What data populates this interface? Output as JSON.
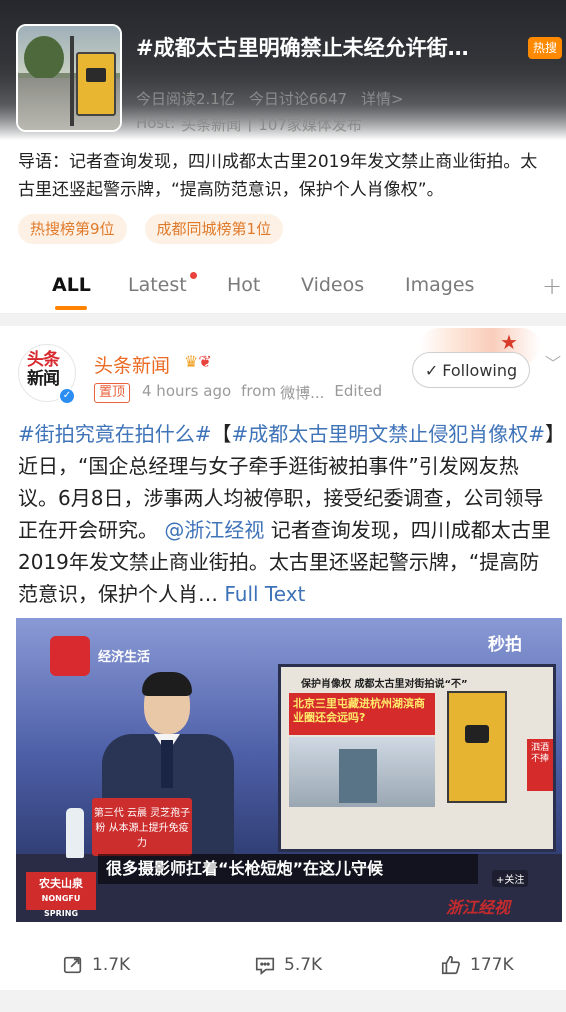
{
  "topic": {
    "title": "#成都太古里明确禁止未经允许街…",
    "badge": "热搜",
    "reads": "今日阅读2.1亿",
    "discussions": "今日讨论6647",
    "details": "详情>",
    "host_label": "Host:",
    "host": "头条新闻",
    "media_count": "107家媒体发布",
    "guide_prefix": "导语：",
    "guide_text": "记者查询发现，四川成都太古里2019年发文禁止商业街拍。太古里还竖起警示牌，“提高防范意识，保护个人肖像权”。",
    "ranks": [
      "热搜榜第9位",
      "成都同城榜第1位"
    ]
  },
  "tabs": {
    "all": "ALL",
    "latest": "Latest",
    "hot": "Hot",
    "videos": "Videos",
    "images": "Images",
    "add": "+"
  },
  "post": {
    "avatar_line1": "头条",
    "avatar_line2": "新闻",
    "author": "头条新闻",
    "pinned": "置顶",
    "time": "4 hours ago",
    "from": "from",
    "source": "微博...",
    "edited": "Edited",
    "follow": "Following",
    "hashtag1": "#街拍究竟在拍什么#",
    "bracket_open": "【",
    "hashtag2": "#成都太古里明文禁止侵犯肖像权#",
    "text1": "】近日，“国企总经理与女子牵手逛街被拍事件”引发网友热议。6月8日，涉事两人均被停职，接受纪委调查，公司领导正在开会研究。",
    "mention": "@浙江经视",
    "text2": " 记者查询发现，四川成都太古里2019年发文禁止商业街拍。太古里还竖起警示牌，“提高防范意识，保护个人肖…",
    "full_text": "Full Text"
  },
  "video": {
    "channel": "经济生活",
    "brand": "秒拍",
    "screen_headline": "保护肖像权 成都太古里对街拍说“不”",
    "screen_red": "北京三里屯藏进杭州湖滨商业圈还会远吗?",
    "side_red": "泗酒不捧",
    "desk_text": "第三代 云晨 灵芝孢子粉 从本源上提升免疫力",
    "caption": "很多摄影师扛着“长枪短炮”在这儿守候",
    "sponsor_line1": "农夫山泉",
    "sponsor_line2": "NONGFU SPRING",
    "watermark": "浙江经视",
    "follow": "+关注"
  },
  "actions": {
    "reposts": "1.7K",
    "comments": "5.7K",
    "likes": "177K"
  },
  "colors": {
    "accent": "#ff8200",
    "link": "#3f73b8",
    "author": "#eb6b24",
    "hot_badge": "#ff8a00"
  }
}
